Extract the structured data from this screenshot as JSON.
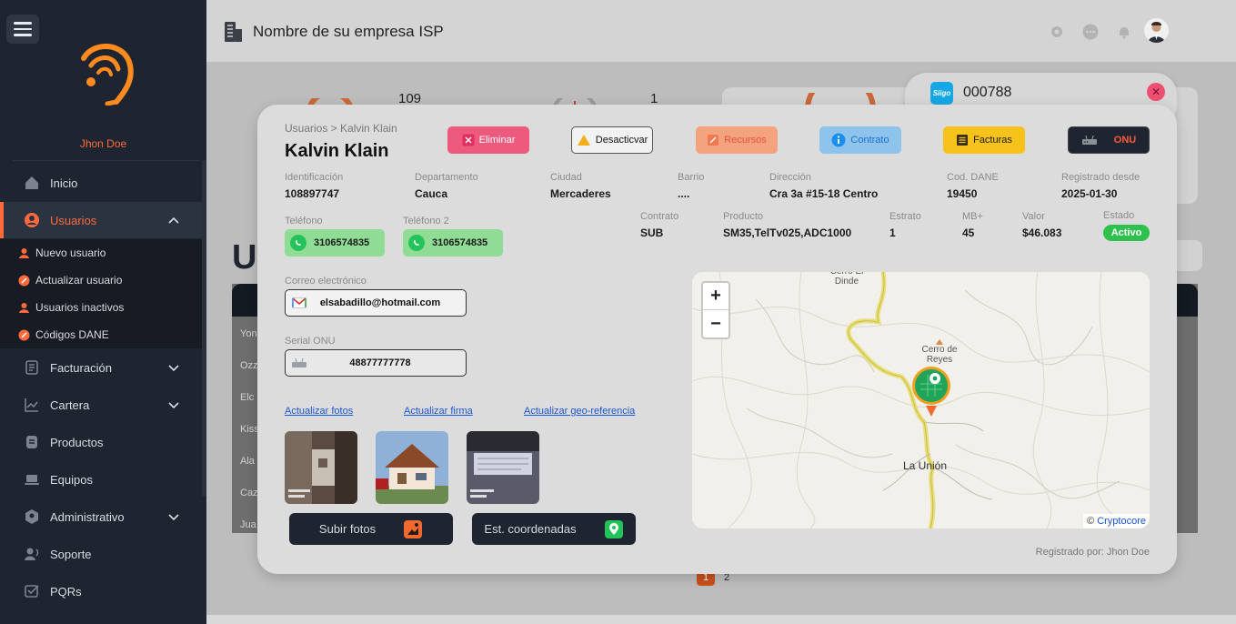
{
  "sidebar": {
    "username": "Jhon Doe",
    "items": [
      {
        "label": "Inicio",
        "icon": "home-icon"
      },
      {
        "label": "Usuarios",
        "icon": "user-icon",
        "active": true
      },
      {
        "label": "Facturación",
        "icon": "invoice-icon"
      },
      {
        "label": "Cartera",
        "icon": "chart-icon"
      },
      {
        "label": "Productos",
        "icon": "products-icon"
      },
      {
        "label": "Equipos",
        "icon": "laptop-icon"
      },
      {
        "label": "Administrativo",
        "icon": "admin-icon"
      },
      {
        "label": "Soporte",
        "icon": "support-icon"
      },
      {
        "label": "PQRs",
        "icon": "pqr-icon"
      }
    ],
    "submenu": [
      "Nuevo usuario",
      "Actualizar usuario",
      "Usuarios inactivos",
      "Códigos DANE"
    ]
  },
  "topbar": {
    "company": "Nombre de su empresa ISP"
  },
  "background": {
    "stat1": "109",
    "stat2": "1",
    "heading_letter": "U",
    "rows": [
      "Yon",
      "Ozz",
      "Elc",
      "Kiss",
      "Ala",
      "Caz",
      "Jua"
    ],
    "pages": [
      "1",
      "2"
    ]
  },
  "siigo": {
    "logo": "Siigo",
    "number": "000788"
  },
  "modal": {
    "breadcrumb": "Usuarios > Kalvin Klain",
    "name": "Kalvin Klain",
    "buttons": {
      "delete": "Eliminar",
      "deactivate": "Desacticvar",
      "resources": "Recursos",
      "contract": "Contrato",
      "invoices": "Facturas",
      "onu": "ONU"
    },
    "info": {
      "id_label": "Identificación",
      "id": "108897747",
      "dept_label": "Departamento",
      "dept": "Cauca",
      "city_label": "Ciudad",
      "city": "Mercaderes",
      "barrio_label": "Barrio",
      "barrio": "....",
      "address_label": "Dirección",
      "address": "Cra 3a #15-18 Centro",
      "dane_label": "Cod. DANE",
      "dane": "19450",
      "since_label": "Registrado desde",
      "since": "2025-01-30"
    },
    "phone_label": "Teléfono",
    "phone": "3106574835",
    "phone2_label": "Teléfono 2",
    "phone2": "3106574835",
    "plan": {
      "contract_label": "Contrato",
      "contract": "SUB",
      "product_label": "Producto",
      "product": "SM35,TelTv025,ADC1000",
      "stratum_label": "Estrato",
      "stratum": "1",
      "mb_label": "MB+",
      "mb": "45",
      "value_label": "Valor",
      "value": "$46.083",
      "state_label": "Estado",
      "state": "Activo"
    },
    "email_label": "Correo electrónico",
    "email": "elsabadillo@hotmail.com",
    "onu_label": "Serial ONU",
    "onu_serial": "48877777778",
    "links": {
      "photos": "Actualizar fotos",
      "signature": "Actualizar firma",
      "geo": "Actualizar geo-referencia"
    },
    "upload_btn": "Subir fotos",
    "coords_btn": "Est. coordenadas",
    "map": {
      "place1": "Cerro El Dinde",
      "place2": "Cerro de Reyes",
      "town": "La Unión",
      "zoom_in": "+",
      "zoom_out": "−",
      "attribution_prefix": "©",
      "attribution": "Cryptocore"
    },
    "registered_by": "Registrado por: Jhon Doe"
  },
  "colors": {
    "accent": "#ff6a3d",
    "sidebar": "#1f2530",
    "status_active": "#2ec14e"
  }
}
